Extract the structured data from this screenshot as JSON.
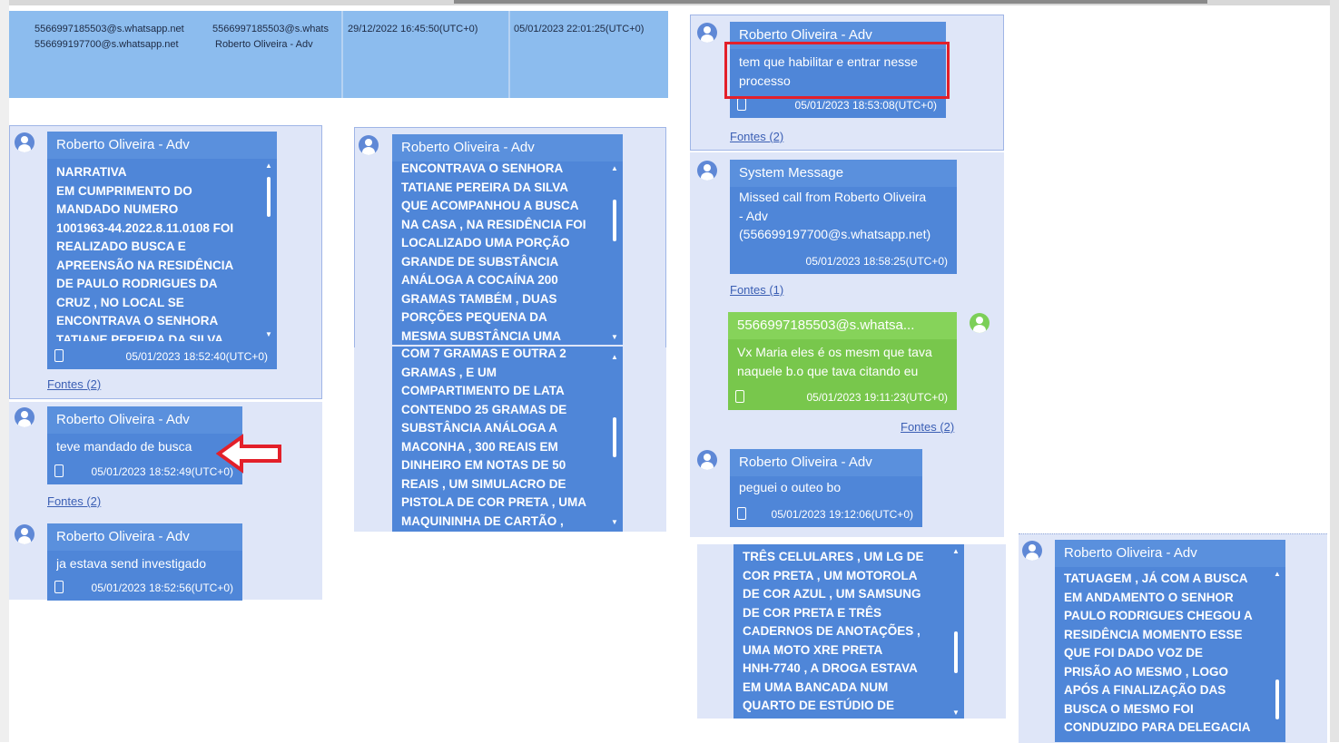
{
  "header": {
    "col1_line1": "5566997185503@s.whatsapp.net",
    "col1_line2": "556699197700@s.whatsapp.net",
    "col2_line1": "5566997185503@s.whats",
    "col2_line2": "Roberto Oliveira - Adv",
    "col3": "29/12/2022 16:45:50(UTC+0)",
    "col4": "05/01/2023 22:01:25(UTC+0)"
  },
  "colors": {
    "bubble": "#4f86d8",
    "bubble_header": "#5a90dd",
    "green_bubble": "#78c74c",
    "panel": "#dfe6f8",
    "highlight": "#e3202a",
    "arrow": "#e3202a"
  },
  "messages": {
    "m1": {
      "sender": "Roberto Oliveira - Adv",
      "text": "NARRATIVA\nEM CUMPRIMENTO DO\nMANDADO NUMERO\n1001963-44.2022.8.11.0108 FOI\nREALIZADO BUSCA E\nAPREENSÃO NA RESIDÊNCIA\nDE PAULO RODRIGUES DA\nCRUZ , NO LOCAL SE\nENCONTRAVA O SENHORA\nTATIANE PEREIRA DA SILVA",
      "timestamp": "05/01/2023 18:52:40(UTC+0)",
      "sources": "Fontes (2)"
    },
    "m2": {
      "sender": "Roberto Oliveira - Adv",
      "text": "teve mandado de busca",
      "timestamp": "05/01/2023 18:52:49(UTC+0)",
      "sources": "Fontes (2)"
    },
    "m3": {
      "sender": "Roberto Oliveira - Adv",
      "text": "ja estava send investigado",
      "timestamp": "05/01/2023 18:52:56(UTC+0)"
    },
    "m4": {
      "sender": "Roberto Oliveira - Adv",
      "text": "ENCONTRAVA O SENHORA\nTATIANE PEREIRA DA SILVA\nQUE ACOMPANHOU A BUSCA\nNA CASA , NA RESIDÊNCIA FOI\nLOCALIZADO UMA PORÇÃO\nGRANDE DE SUBSTÂNCIA\nANÁLOGA A COCAÍNA 200\nGRAMAS TAMBÉM , DUAS\nPORÇÕES PEQUENA DA\nMESMA SUBSTÂNCIA UMA"
    },
    "m5": {
      "text": "COM 7 GRAMAS E OUTRA 2\nGRAMAS , E UM\nCOMPARTIMENTO DE LATA\nCONTENDO 25 GRAMAS DE\nSUBSTÂNCIA ANÁLOGA A\nMACONHA , 300 REAIS EM\nDINHEIRO EM NOTAS DE 50\nREAIS , UM SIMULACRO DE\nPISTOLA DE COR PRETA , UMA\nMAQUININHA DE CARTÃO ,"
    },
    "m6": {
      "sender": "Roberto Oliveira - Adv",
      "text": "tem que habilitar e entrar nesse\nprocesso",
      "timestamp": "05/01/2023 18:53:08(UTC+0)",
      "sources": "Fontes (2)"
    },
    "m7": {
      "sender": "System Message",
      "text": "Missed call from Roberto Oliveira\n- Adv\n(556699197700@s.whatsapp.net)",
      "timestamp": "05/01/2023 18:58:25(UTC+0)",
      "sources": "Fontes (1)"
    },
    "m8": {
      "sender": "5566997185503@s.whatsa...",
      "text": "Vx Maria eles é os mesm que tava\nnaquele b.o que tava citando eu",
      "timestamp": "05/01/2023 19:11:23(UTC+0)",
      "sources": "Fontes (2)"
    },
    "m9": {
      "sender": "Roberto Oliveira - Adv",
      "text": "peguei o outeo bo",
      "timestamp": "05/01/2023 19:12:06(UTC+0)"
    },
    "m10": {
      "text": "TRÊS CELULARES , UM LG DE\nCOR PRETA , UM MOTOROLA\nDE COR AZUL , UM SAMSUNG\nDE COR PRETA E TRÊS\nCADERNOS DE ANOTAÇÕES ,\nUMA MOTO XRE PRETA\nHNH-7740 , A DROGA ESTAVA\nEM UMA BANCADA NUM\nQUARTO DE ESTÚDIO DE"
    },
    "m11": {
      "sender": "Roberto Oliveira - Adv",
      "text": "TATUAGEM , JÁ COM A BUSCA\nEM ANDAMENTO O SENHOR\nPAULO RODRIGUES CHEGOU A\nRESIDÊNCIA MOMENTO ESSE\nQUE FOI DADO VOZ DE\nPRISÃO AO MESMO , LOGO\nAPÓS A FINALIZAÇÃO DAS\nBUSCA O MESMO FOI\nCONDUZIDO PARA DELEGACIA"
    }
  }
}
